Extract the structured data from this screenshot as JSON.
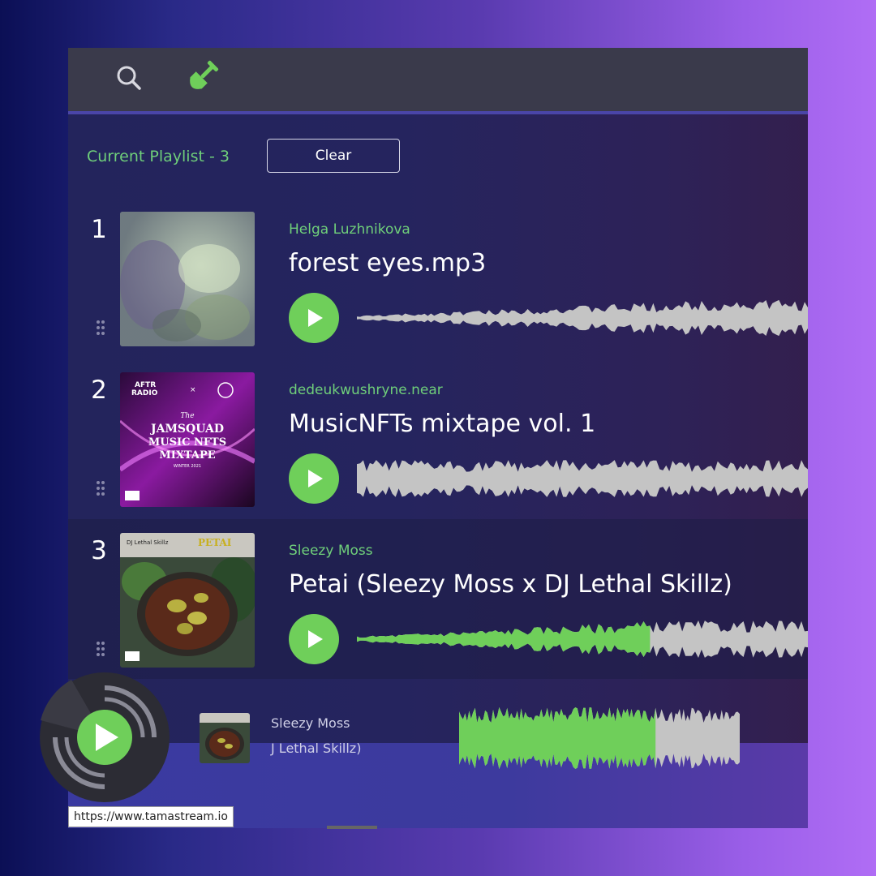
{
  "colors": {
    "accent_green": "#6fcf5a",
    "text_green": "#6fcf7a",
    "wave_grey": "#c4c4c4"
  },
  "topbar": {
    "icons": [
      "search-icon",
      "shovel-icon"
    ]
  },
  "playlist": {
    "title": "Current Playlist - 3",
    "clear_label": "Clear"
  },
  "tracks": [
    {
      "number": "1",
      "artist": "Helga Luzhnikova",
      "title": "forest eyes.mp3",
      "progress": 0
    },
    {
      "number": "2",
      "artist": "dedeukwushryne.near",
      "title": "MusicNFTs mixtape vol. 1",
      "progress": 0
    },
    {
      "number": "3",
      "artist": "Sleezy Moss",
      "title": "Petai (Sleezy Moss x DJ Lethal Skillz)",
      "progress": 0.65
    }
  ],
  "now_playing": {
    "artist": "Sleezy Moss",
    "title_visible": "J Lethal Skillz)",
    "progress": 0.7
  },
  "status_url": "https://www.tamastream.io"
}
